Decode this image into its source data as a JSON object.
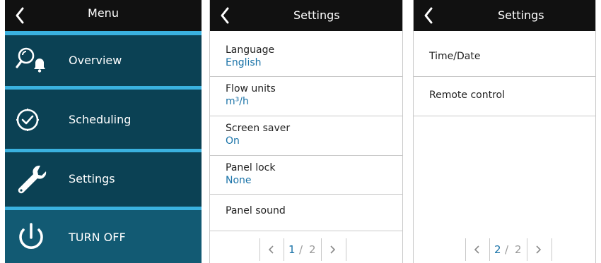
{
  "menu_screen": {
    "title": "Menu",
    "items": [
      {
        "label": "Overview",
        "icon": "overview-search-bell-icon"
      },
      {
        "label": "Scheduling",
        "icon": "clock-check-icon"
      },
      {
        "label": "Settings",
        "icon": "wrench-icon"
      }
    ],
    "turn_off": {
      "label": "TURN OFF",
      "icon": "power-icon"
    }
  },
  "settings_page1": {
    "title": "Settings",
    "rows": [
      {
        "title": "Language",
        "value": "English"
      },
      {
        "title": "Flow units",
        "value": "m³/h"
      },
      {
        "title": "Screen saver",
        "value": "On"
      },
      {
        "title": "Panel lock",
        "value": "None"
      },
      {
        "title": "Panel sound"
      }
    ],
    "pager": {
      "current": "1",
      "separator": "/",
      "total": "2"
    }
  },
  "settings_page2": {
    "title": "Settings",
    "rows": [
      {
        "title": "Time/Date"
      },
      {
        "title": "Remote control"
      }
    ],
    "pager": {
      "current": "2",
      "separator": "/",
      "total": "2"
    }
  },
  "colors": {
    "header": "#111111",
    "menu_background": "#0b4154",
    "turn_off_background": "#125a73",
    "accent": "#3ab1df",
    "value_text": "#1a73a8"
  }
}
